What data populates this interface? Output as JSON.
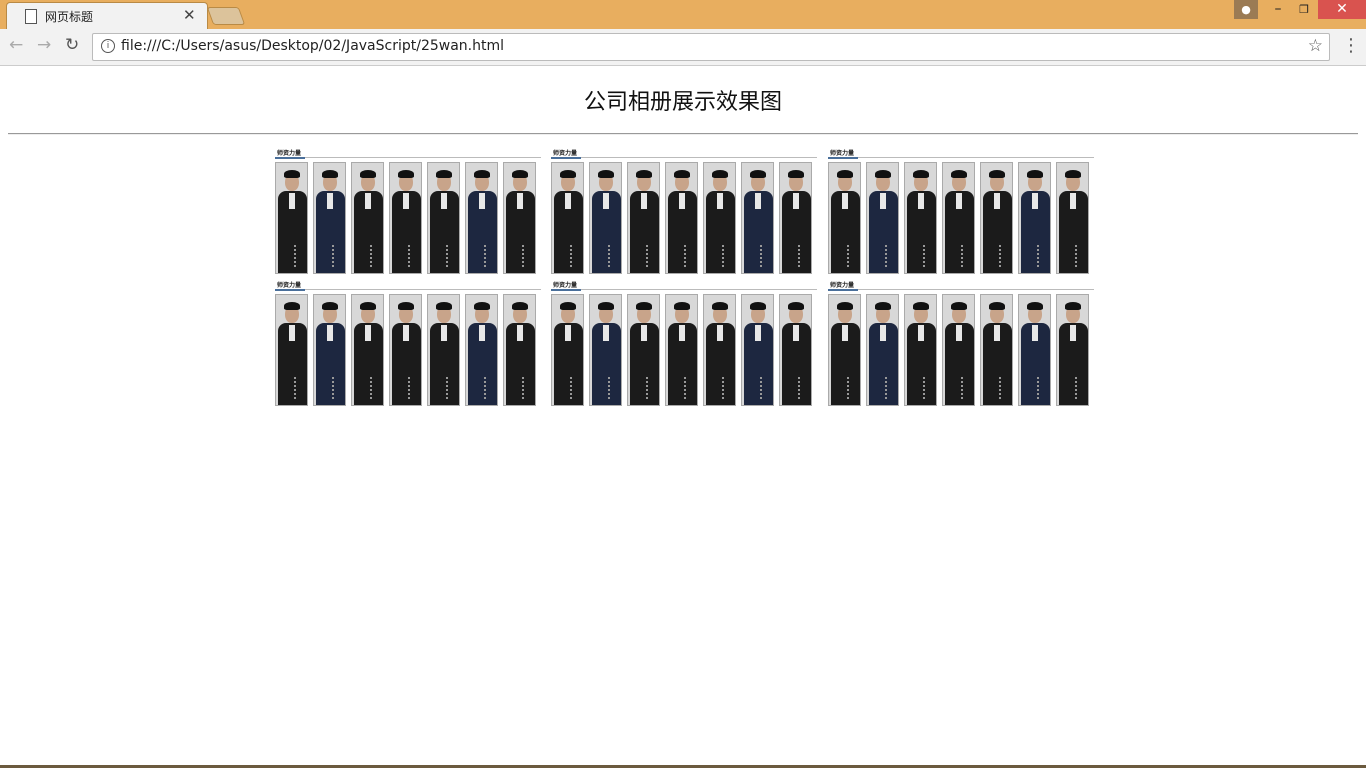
{
  "browser": {
    "tab_title": "网页标题",
    "url": "file:///C:/Users/asus/Desktop/02/JavaScript/25wan.html"
  },
  "page": {
    "title": "公司相册展示效果图"
  },
  "albums": [
    {
      "label": "师资力量"
    },
    {
      "label": "师资力量"
    },
    {
      "label": "师资力量"
    },
    {
      "label": "师资力量"
    },
    {
      "label": "师资力量"
    },
    {
      "label": "师资力量"
    }
  ],
  "photos_per_album": 7,
  "colors": {
    "titlebar": "#e8ae5f",
    "close_button": "#d9534f",
    "accent_rule": "#4a6f9a"
  }
}
